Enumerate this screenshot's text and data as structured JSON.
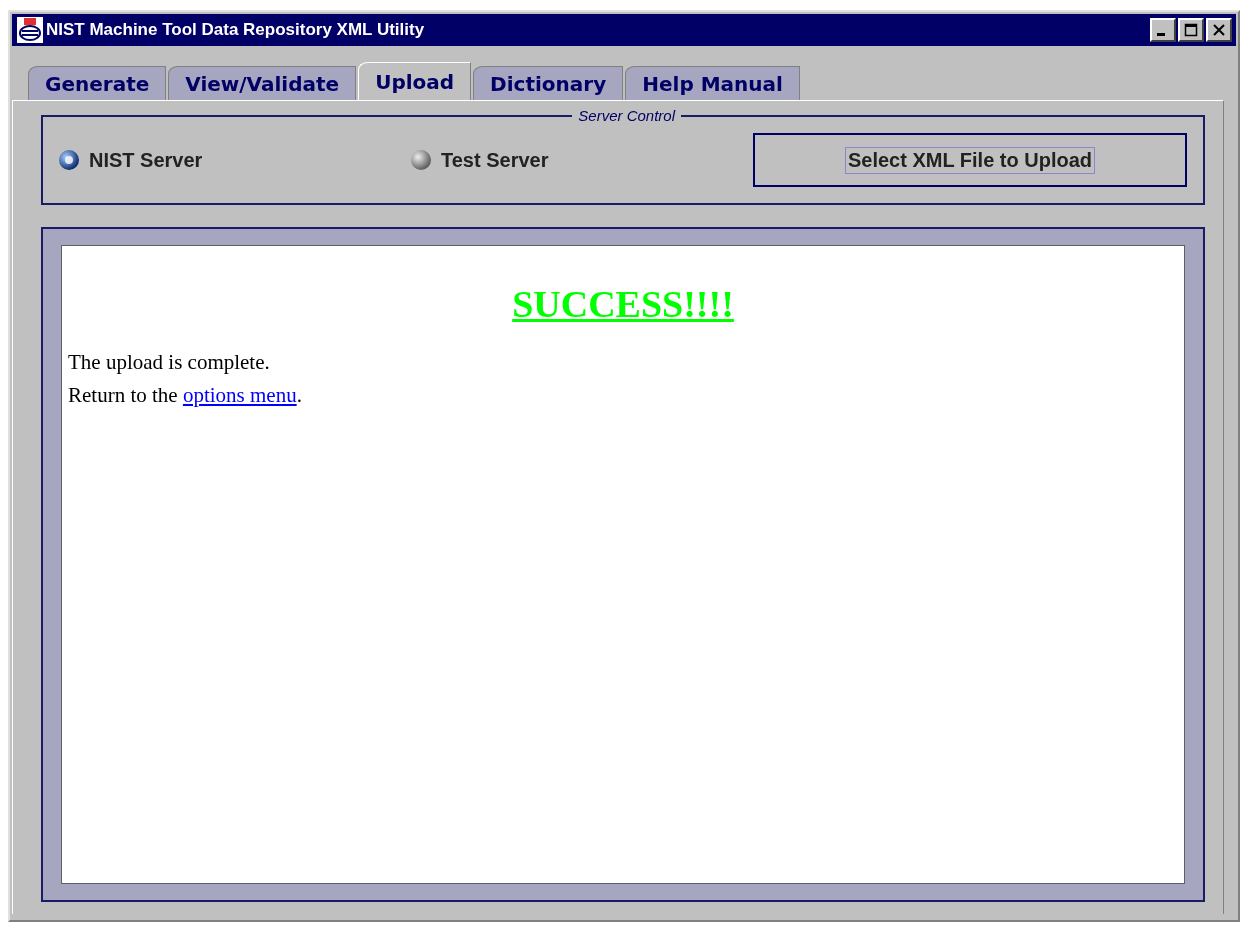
{
  "window": {
    "title": "NIST Machine Tool Data Repository XML Utility"
  },
  "tabs": [
    {
      "label": "Generate",
      "selected": false
    },
    {
      "label": "View/Validate",
      "selected": false
    },
    {
      "label": "Upload",
      "selected": true
    },
    {
      "label": "Dictionary",
      "selected": false
    },
    {
      "label": "Help Manual",
      "selected": false
    }
  ],
  "server_control": {
    "title": "Server Control",
    "servers": [
      {
        "label": "NIST Server",
        "selected": true
      },
      {
        "label": "Test Server",
        "selected": false
      }
    ],
    "button": "Select XML File to Upload"
  },
  "result": {
    "heading": "SUCCESS!!!!",
    "message": "The upload is complete.",
    "return_before": "Return to the ",
    "return_link": "options menu",
    "return_after": "."
  }
}
